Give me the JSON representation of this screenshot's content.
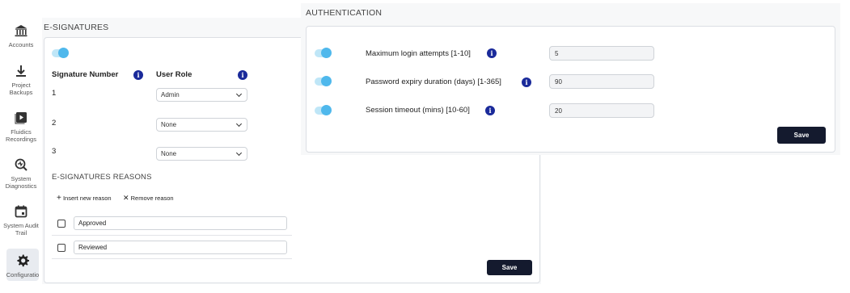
{
  "sidebar": {
    "items": [
      {
        "label": "Accounts",
        "icon": "bank-icon"
      },
      {
        "label": "Project Backups",
        "icon": "download-icon"
      },
      {
        "label": "Fluidics Recordings",
        "icon": "play-icon"
      },
      {
        "label": "System Diagnostics",
        "icon": "diagnostics-icon"
      },
      {
        "label": "System Audit Trail",
        "icon": "calendar-icon"
      },
      {
        "label": "Configuratio",
        "icon": "gear-icon"
      }
    ]
  },
  "esignatures": {
    "title": "E-SIGNATURES",
    "enabled": true,
    "col_signature_number": "Signature Number",
    "col_user_role": "User Role",
    "rows": [
      {
        "number": "1",
        "role": "Admin"
      },
      {
        "number": "2",
        "role": "None"
      },
      {
        "number": "3",
        "role": "None"
      }
    ],
    "reasons_title": "E-SIGNATURES REASONS",
    "insert_label": "Insert new reason",
    "remove_label": "Remove reason",
    "reasons": [
      "Approved",
      "Reviewed"
    ],
    "save_label": "Save"
  },
  "authentication": {
    "title": "AUTHENTICATION",
    "settings": [
      {
        "label": "Maximum login attempts [1-10]",
        "value": "5",
        "enabled": true
      },
      {
        "label": "Password expiry duration (days) [1-365]",
        "value": "90",
        "enabled": true
      },
      {
        "label": "Session timeout (mins) [10-60]",
        "value": "20",
        "enabled": true
      }
    ],
    "save_label": "Save"
  },
  "colors": {
    "accent": "#4fb8ec",
    "info": "#1a2a9a",
    "button": "#141a2e"
  }
}
